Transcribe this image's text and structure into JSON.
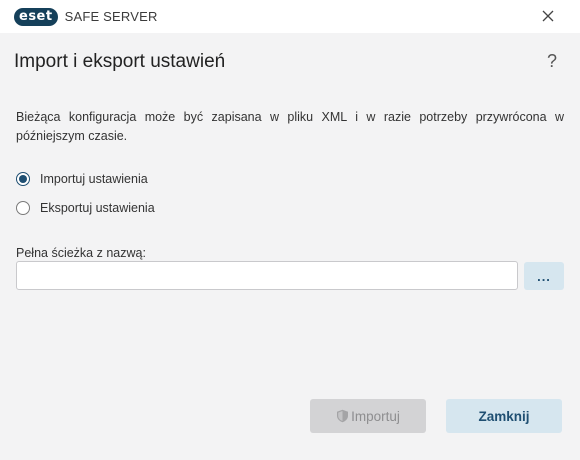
{
  "window": {
    "brand": "eset",
    "product": "SAFE SERVER",
    "close_icon": "close-icon"
  },
  "dialog": {
    "title": "Import i eksport ustawień",
    "help_glyph": "?",
    "description": "Bieżąca konfiguracja może być zapisana w pliku XML i w razie potrzeby przywrócona w późniejszym czasie.",
    "options": [
      {
        "label": "Importuj ustawienia",
        "selected": true
      },
      {
        "label": "Eksportuj ustawienia",
        "selected": false
      }
    ],
    "path": {
      "label": "Pełna ścieżka z nazwą:",
      "value": "",
      "placeholder": ""
    },
    "browse_label": "...",
    "buttons": {
      "import_label": "Importuj",
      "import_enabled": false,
      "close_label": "Zamknij"
    }
  },
  "colors": {
    "accent": "#1f4f72",
    "button_secondary_bg": "#d6e6ef",
    "disabled_bg": "#d3d3d5",
    "background": "#f3f3f4"
  }
}
